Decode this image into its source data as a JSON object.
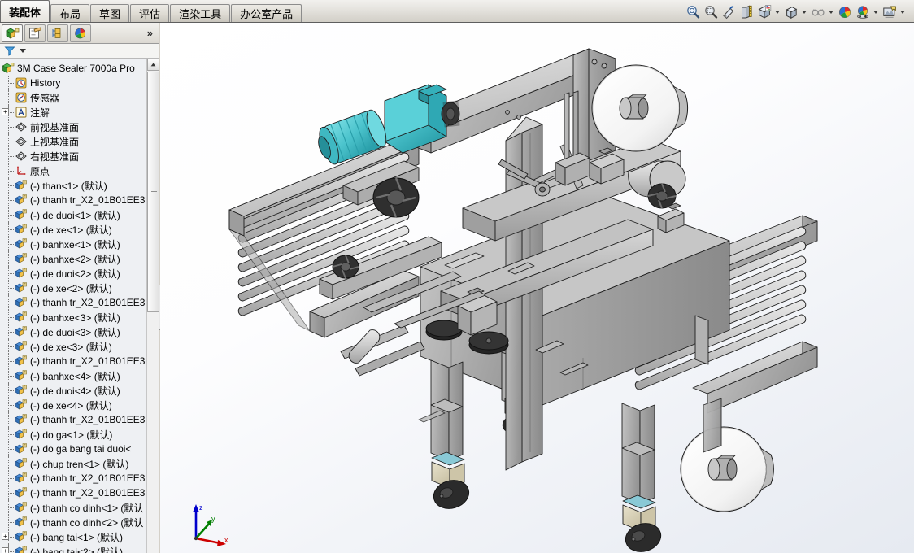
{
  "window": {
    "title": "3M Case Sealer 7000a Pro"
  },
  "ribbon": {
    "tabs": [
      {
        "label": "装配体",
        "name": "tab-assembly",
        "active": true
      },
      {
        "label": "布局",
        "name": "tab-layout",
        "active": false
      },
      {
        "label": "草图",
        "name": "tab-sketch",
        "active": false
      },
      {
        "label": "评估",
        "name": "tab-evaluate",
        "active": false
      },
      {
        "label": "渲染工具",
        "name": "tab-render-tools",
        "active": false
      },
      {
        "label": "办公室产品",
        "name": "tab-office-products",
        "active": false
      }
    ],
    "toolbar": [
      {
        "icon": "zoom-to-fit-icon",
        "caret": false
      },
      {
        "icon": "zoom-to-area-icon",
        "caret": false
      },
      {
        "icon": "zoom-in-out-icon",
        "caret": false
      },
      {
        "icon": "section-view-icon",
        "caret": false
      },
      {
        "icon": "view-orientation-icon",
        "caret": true
      },
      {
        "icon": "display-style-icon",
        "caret": true
      },
      {
        "icon": "hide-show-items-icon",
        "caret": true
      },
      {
        "icon": "edit-appearance-icon",
        "caret": false
      },
      {
        "icon": "apply-scene-icon",
        "caret": true
      },
      {
        "icon": "view-settings-icon",
        "caret": true
      }
    ]
  },
  "left_panel": {
    "tabs": [
      {
        "name": "feature-manager-tab",
        "icon": "feature-tree-icon",
        "active": true
      },
      {
        "name": "property-manager-tab",
        "icon": "property-manager-icon",
        "active": false
      },
      {
        "name": "configuration-manager-tab",
        "icon": "configuration-manager-icon",
        "active": false
      },
      {
        "name": "display-manager-tab",
        "icon": "display-manager-icon",
        "active": false
      }
    ],
    "overflow_label": "»",
    "filter": {
      "icon": "filter-icon",
      "placeholder": ""
    },
    "tree": [
      {
        "label": "3M Case Sealer 7000a Pro",
        "icon": "assembly-icon",
        "level": 0,
        "expander": ""
      },
      {
        "label": "History",
        "icon": "history-icon",
        "level": 1,
        "expander": ""
      },
      {
        "label": "传感器",
        "icon": "sensors-icon",
        "level": 1,
        "expander": ""
      },
      {
        "label": "注解",
        "icon": "annotations-icon",
        "level": 1,
        "expander": "+"
      },
      {
        "label": "前视基准面",
        "icon": "plane-icon",
        "level": 1,
        "expander": ""
      },
      {
        "label": "上视基准面",
        "icon": "plane-icon",
        "level": 1,
        "expander": ""
      },
      {
        "label": "右视基准面",
        "icon": "plane-icon",
        "level": 1,
        "expander": ""
      },
      {
        "label": "原点",
        "icon": "origin-icon",
        "level": 1,
        "expander": ""
      },
      {
        "label": "(-) than<1> (默认)",
        "icon": "part-icon",
        "level": 1,
        "expander": ""
      },
      {
        "label": "(-) thanh tr_X2_01B01EE3",
        "icon": "part-icon",
        "level": 1,
        "expander": ""
      },
      {
        "label": "(-) de duoi<1> (默认)",
        "icon": "part-icon",
        "level": 1,
        "expander": ""
      },
      {
        "label": "(-) de xe<1> (默认)",
        "icon": "part-icon",
        "level": 1,
        "expander": ""
      },
      {
        "label": "(-) banhxe<1> (默认)",
        "icon": "part-icon",
        "level": 1,
        "expander": ""
      },
      {
        "label": "(-) banhxe<2> (默认)",
        "icon": "part-icon",
        "level": 1,
        "expander": ""
      },
      {
        "label": "(-) de duoi<2> (默认)",
        "icon": "part-icon",
        "level": 1,
        "expander": ""
      },
      {
        "label": "(-) de xe<2> (默认)",
        "icon": "part-icon",
        "level": 1,
        "expander": ""
      },
      {
        "label": "(-) thanh tr_X2_01B01EE3",
        "icon": "part-icon",
        "level": 1,
        "expander": ""
      },
      {
        "label": "(-) banhxe<3> (默认)",
        "icon": "part-icon",
        "level": 1,
        "expander": ""
      },
      {
        "label": "(-) de duoi<3> (默认)",
        "icon": "part-icon",
        "level": 1,
        "expander": ""
      },
      {
        "label": "(-) de xe<3> (默认)",
        "icon": "part-icon",
        "level": 1,
        "expander": ""
      },
      {
        "label": "(-) thanh tr_X2_01B01EE3",
        "icon": "part-icon",
        "level": 1,
        "expander": ""
      },
      {
        "label": "(-) banhxe<4> (默认)",
        "icon": "part-icon",
        "level": 1,
        "expander": ""
      },
      {
        "label": "(-) de duoi<4> (默认)",
        "icon": "part-icon",
        "level": 1,
        "expander": ""
      },
      {
        "label": "(-) de xe<4> (默认)",
        "icon": "part-icon",
        "level": 1,
        "expander": ""
      },
      {
        "label": "(-) thanh tr_X2_01B01EE3",
        "icon": "part-icon",
        "level": 1,
        "expander": ""
      },
      {
        "label": "(-) do ga<1> (默认)",
        "icon": "part-icon",
        "level": 1,
        "expander": ""
      },
      {
        "label": "(-) do ga bang tai duoi<",
        "icon": "part-icon",
        "level": 1,
        "expander": ""
      },
      {
        "label": "(-) chup tren<1> (默认)",
        "icon": "part-icon",
        "level": 1,
        "expander": ""
      },
      {
        "label": "(-) thanh tr_X2_01B01EE3",
        "icon": "part-icon",
        "level": 1,
        "expander": ""
      },
      {
        "label": "(-) thanh tr_X2_01B01EE3",
        "icon": "part-icon",
        "level": 1,
        "expander": ""
      },
      {
        "label": "(-) thanh co dinh<1> (默认",
        "icon": "part-icon",
        "level": 1,
        "expander": ""
      },
      {
        "label": "(-) thanh co dinh<2> (默认",
        "icon": "part-icon",
        "level": 1,
        "expander": ""
      },
      {
        "label": "(-) bang tai<1> (默认)",
        "icon": "part-icon",
        "level": 1,
        "expander": "+"
      },
      {
        "label": "(-) bang tai<2> (默认)",
        "icon": "part-icon",
        "level": 1,
        "expander": "+"
      }
    ]
  },
  "viewport": {
    "model_name": "3M Case Sealer 7000a Pro",
    "axes": {
      "x": "x",
      "y": "y",
      "z": "z"
    },
    "colors": {
      "steel_light": "#d8d8d8",
      "steel_mid": "#b8b8b8",
      "steel_dark": "#9a9a9a",
      "steel_shadow": "#848484",
      "motor_teal": "#59cdd4",
      "motor_teal_dark": "#2fa8b4",
      "caster_tan": "#ddd6be",
      "wheel_black": "#2b2b2b",
      "tape_white": "#f7f7f7",
      "outline": "#1d1d1d",
      "axis_x": "#cc0000",
      "axis_y": "#007f00",
      "axis_z": "#0000cc"
    }
  }
}
